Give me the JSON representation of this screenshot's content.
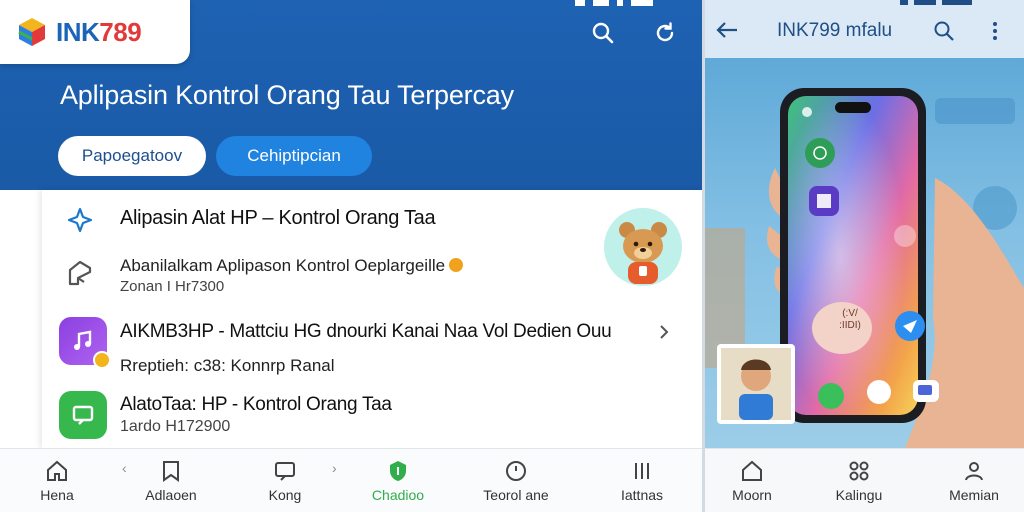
{
  "left": {
    "brand": {
      "name": "INK",
      "number": "789"
    },
    "hero_title": "Aplipasin Kontrol Orang Tau Terpercay",
    "pills": [
      {
        "label": "Papoegatoov"
      },
      {
        "label": "Cehiptipcian"
      }
    ],
    "rows": [
      {
        "title": "Alipasin Alat HP – Kontrol Orang Taa"
      },
      {
        "subtitle": "Abanilalkam Aplipason Kontrol Oeplargeille",
        "meta": "Zonan I Hr7300"
      },
      {
        "title": "AIKMB3HP - Mattciu HG dnourki Kanai Naa Vol Dedien Ouu",
        "subtitle": "Rreptieh: c38: Konnrp Ranal"
      },
      {
        "title": "AlatoTaa: HP - Kontrol Orang Taa",
        "meta": "1ardo H172900"
      }
    ],
    "bottom_nav": [
      {
        "label": "Hena",
        "icon": "home-icon"
      },
      {
        "label": "Adlaoen",
        "icon": "bookmark-icon"
      },
      {
        "label": "Kong",
        "icon": "message-icon"
      },
      {
        "label": "Chadioo",
        "icon": "shield-icon"
      },
      {
        "label": "Teorol ane",
        "icon": "clock-icon"
      },
      {
        "label": "Iattnas",
        "icon": "bars-icon"
      }
    ],
    "nav_arrows": [
      "‹",
      "›"
    ],
    "colors": {
      "hero": "#1e62b3",
      "accent_button": "#2183e0",
      "active_nav": "#2fae4b",
      "brand_red": "#e23a3a"
    }
  },
  "right": {
    "title": "INK799 mfalu",
    "phone_badge": "(:V/\n:IIDI)",
    "bottom_nav": [
      {
        "label": "Moorn",
        "icon": "home-outline-icon"
      },
      {
        "label": "Kalingu",
        "icon": "grid-icon"
      },
      {
        "label": "Memian",
        "icon": "person-icon"
      }
    ]
  }
}
